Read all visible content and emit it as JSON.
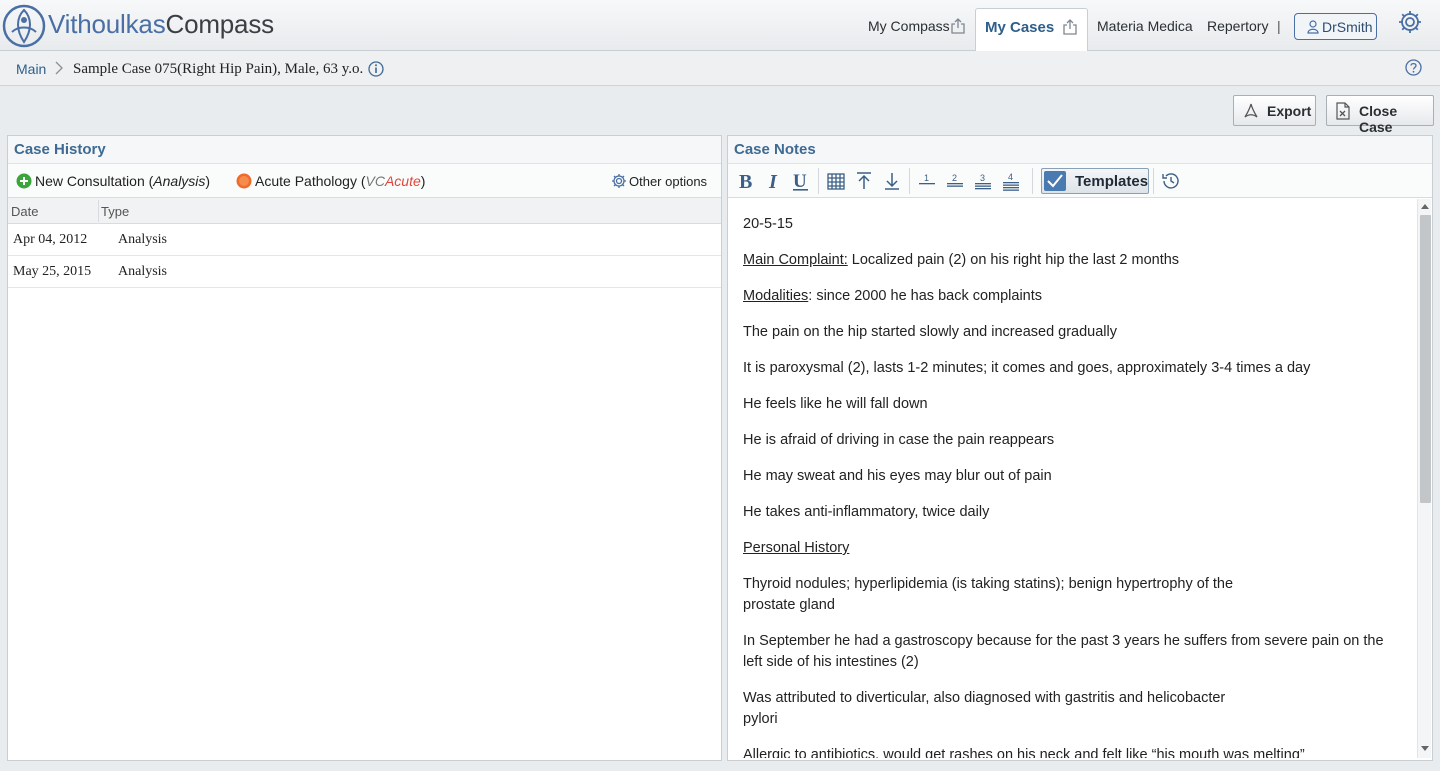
{
  "app": {
    "brand_part1": "Vithoulkas",
    "brand_part2": "Compass"
  },
  "nav": {
    "my_compass": "My Compass",
    "my_cases": "My Cases",
    "materia_medica": "Materia Medica",
    "repertory": "Repertory",
    "separator": "|",
    "user": "DrSmith"
  },
  "breadcrumb": {
    "main": "Main",
    "case": "Sample Case 075(Right Hip Pain), Male, 63 y.o."
  },
  "actions": {
    "export": "Export",
    "close_case": "Close Case"
  },
  "case_history": {
    "title": "Case History",
    "new_consultation": "New Consultation (",
    "new_consultation_em": "Analysis",
    "new_consultation_end": ")",
    "acute_pathology": "Acute Pathology (",
    "acute_vc": "VC",
    "acute_word": "Acute",
    "acute_end": ")",
    "other_options": "Other options",
    "columns": [
      "Date",
      "Type"
    ],
    "rows": [
      {
        "date": "Apr 04, 2012",
        "type": "Analysis"
      },
      {
        "date": "May 25, 2015",
        "type": "Analysis"
      }
    ]
  },
  "case_notes": {
    "title": "Case Notes",
    "templates_label": "Templates",
    "toolbar_heading_labels": [
      "1",
      "2",
      "3",
      "4"
    ],
    "lines": {
      "l1": "20-5-15",
      "l2a": "Main Complaint:",
      "l2b": " Localized pain (2) on his right hip the last 2 months",
      "l3a": "Modalities",
      "l3b": ": since 2000 he has back complaints",
      "l4": "The pain on the hip started slowly and increased gradually",
      "l5": "It is paroxysmal (2), lasts 1-2 minutes; it comes and goes, approximately 3-4 times a day",
      "l6": "He feels like he will fall down",
      "l7": "He is afraid of driving in case the pain reappears",
      "l8": "He may sweat and his eyes may blur out of pain",
      "l9": "He takes anti-inflammatory, twice daily",
      "l10": "Personal History",
      "l11a": "Thyroid nodules; hyperlipidemia (is taking statins); benign hypertrophy of the",
      "l11b": "prostate gland",
      "l12a": "In September he had a gastroscopy because for the past 3 years he suffers from severe pain on the",
      "l12b": "left side of his intestines (2)",
      "l13a": "Was attributed to diverticular, also diagnosed with gastritis and helicobacter",
      "l13b": "pylori",
      "l14": "Allergic to antibiotics, would get rashes on his neck and felt like “his mouth was melting”"
    }
  },
  "colors": {
    "accent_blue": "#3e6a93",
    "link_blue": "#2e5f8a",
    "acute_red": "#e0473a",
    "add_green": "#3aa53a",
    "acute_orange": "#f06a2a"
  }
}
